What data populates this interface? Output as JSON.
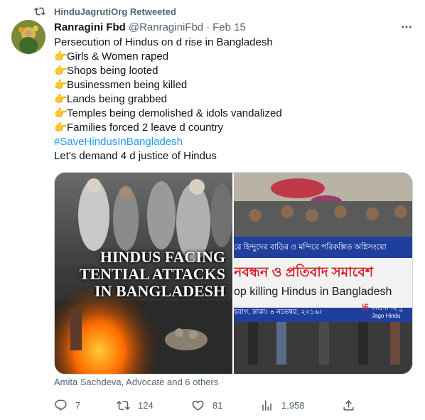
{
  "retweet_context": "HinduJagrutiOrg Retweeted",
  "author": {
    "name": "Ranragini Fbd",
    "handle": "@RanraginiFbd",
    "separator": "·",
    "date": "Feb 15"
  },
  "tweet_lines": {
    "l0": "Persecution of Hindus on d rise in Bangladesh",
    "l1": "Girls & Women raped",
    "l2": "Shops being looted",
    "l3": "Businessmen being killed",
    "l4": "Lands being grabbed",
    "l5": "Temples being demolished & idols vandalized",
    "l6": "Families forced 2 leave d country",
    "l7": "#SaveHindusInBangladesh",
    "l8": "Let's demand 4 d justice of Hindus"
  },
  "emoji": "👉",
  "media": {
    "left_overlay": [
      "HINDUS FACING",
      "TENTIAL ATTACKS",
      "IN BANGLADESH"
    ],
    "right_banner_bengali": "রে হিন্দুদের বাড়ির ও মন্দিরে পরিকল্পিত অগ্নিসংযো",
    "right_banner_main": "নবন্ধন ও প্রতিবাদ সমাবেশ",
    "right_banner_english": "op killing Hindus in Bangladesh",
    "right_banner_footer": "হবাগ, ঢাকা। ৪ নভেম্বর, ২০১৬।",
    "right_logo_text": "জাগো হিন্দু",
    "right_logo_sub": "Jago Hindu"
  },
  "liked_by": "Amita Sachdeva, Advocate and 6 others",
  "counts": {
    "replies": "7",
    "retweets": "124",
    "likes": "81",
    "views": "1,958"
  },
  "colors": {
    "text": "#0f1419",
    "secondary": "#536471",
    "link": "#1d9bf0",
    "banner_blue": "#1f3f9c",
    "banner_red": "#d2232a"
  },
  "icons": [
    "retweet-icon",
    "more-icon",
    "reply-icon",
    "retweet-icon",
    "like-icon",
    "views-icon",
    "share-icon"
  ]
}
